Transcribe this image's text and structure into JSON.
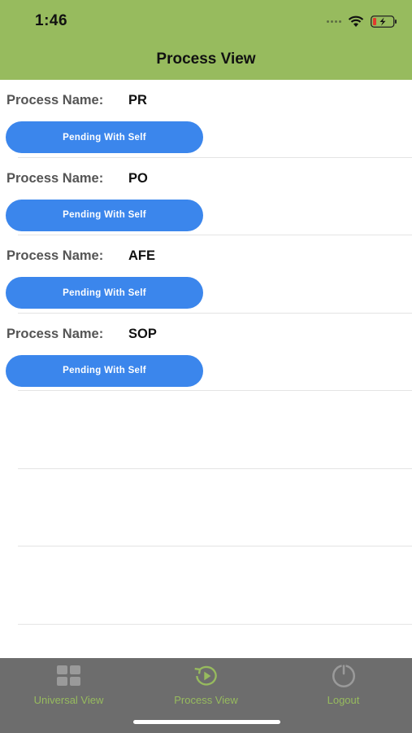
{
  "status_bar": {
    "time": "1:46"
  },
  "header": {
    "title": "Process View"
  },
  "processes": [
    {
      "label": "Process Name:",
      "name": "PR",
      "button": "Pending With Self"
    },
    {
      "label": "Process Name:",
      "name": "PO",
      "button": "Pending With Self"
    },
    {
      "label": "Process Name:",
      "name": "AFE",
      "button": "Pending With Self"
    },
    {
      "label": "Process Name:",
      "name": "SOP",
      "button": "Pending With Self"
    }
  ],
  "tabbar": {
    "items": [
      {
        "label": "Universal View",
        "icon": "grid-icon"
      },
      {
        "label": "Process View",
        "icon": "process-icon"
      },
      {
        "label": "Logout",
        "icon": "power-icon"
      }
    ]
  },
  "colors": {
    "header": "#97bb5e",
    "button": "#3b86ec",
    "tabbar": "#6d6d6d",
    "tab_label": "#97bb5e"
  }
}
